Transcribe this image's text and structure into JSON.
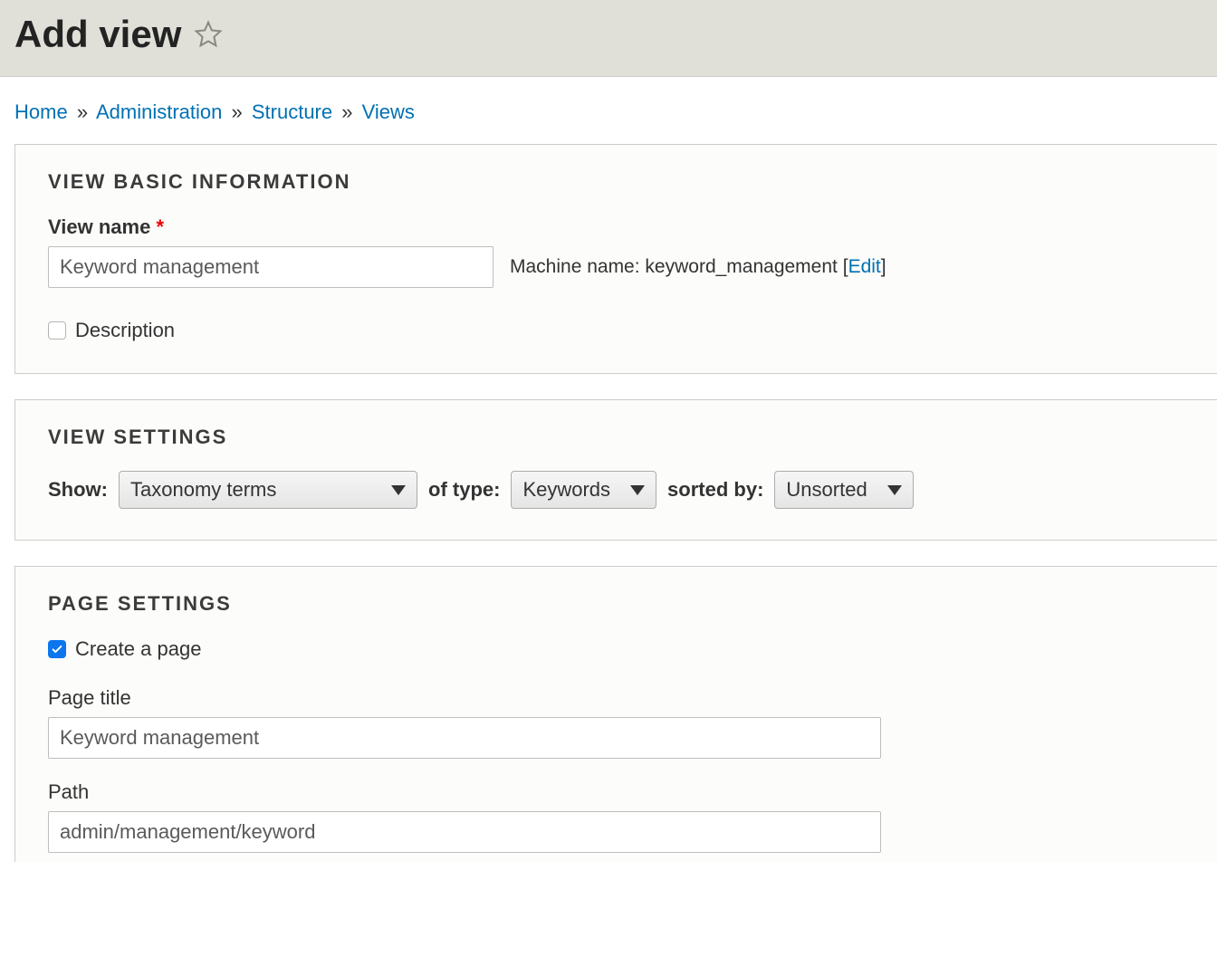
{
  "header": {
    "title": "Add view"
  },
  "breadcrumb": {
    "items": [
      "Home",
      "Administration",
      "Structure",
      "Views"
    ],
    "sep": "»"
  },
  "basic": {
    "section_title": "VIEW BASIC INFORMATION",
    "view_name_label": "View name",
    "view_name_value": "Keyword management",
    "machine_label": "Machine name:",
    "machine_value": "keyword_management",
    "edit_label": "Edit",
    "description_label": "Description",
    "description_checked": false
  },
  "settings": {
    "section_title": "VIEW SETTINGS",
    "show_label": "Show:",
    "show_value": "Taxonomy terms",
    "of_type_label": "of type:",
    "of_type_value": "Keywords",
    "sorted_by_label": "sorted by:",
    "sorted_by_value": "Unsorted"
  },
  "page": {
    "section_title": "PAGE SETTINGS",
    "create_page_label": "Create a page",
    "create_page_checked": true,
    "page_title_label": "Page title",
    "page_title_value": "Keyword management",
    "path_label": "Path",
    "path_value": "admin/management/keyword"
  }
}
